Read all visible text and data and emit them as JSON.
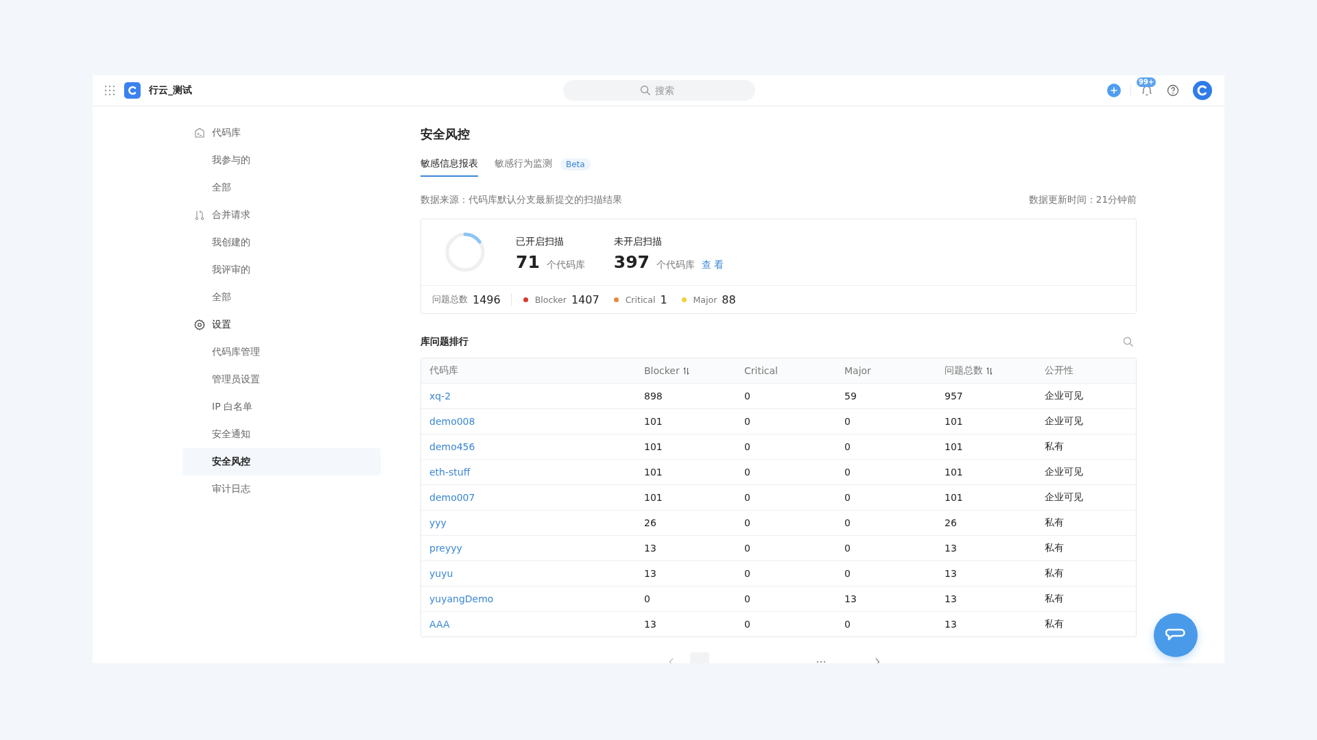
{
  "header": {
    "title": "行云_测试",
    "search": {
      "placeholder": "搜索"
    },
    "notification_badge": "99+"
  },
  "sidebar": {
    "items": [
      {
        "label": "代码库",
        "kind": "repo",
        "selected": false,
        "children": [
          {
            "label": "我参与的",
            "selected": false
          },
          {
            "label": "全部",
            "selected": false
          }
        ]
      },
      {
        "label": "合并请求",
        "kind": "merge",
        "selected": false,
        "children": [
          {
            "label": "我创建的",
            "selected": false
          },
          {
            "label": "我评审的",
            "selected": false
          },
          {
            "label": "全部",
            "selected": false
          }
        ]
      },
      {
        "label": "设置",
        "kind": "settings",
        "selected": false,
        "children": [
          {
            "label": "代码库管理",
            "selected": false
          },
          {
            "label": "管理员设置",
            "selected": false
          },
          {
            "label": "IP 白名单",
            "selected": false
          },
          {
            "label": "安全通知",
            "selected": false
          },
          {
            "label": "安全风控",
            "selected": true
          },
          {
            "label": "审计日志",
            "selected": false
          }
        ]
      }
    ]
  },
  "page": {
    "title": "安全风控",
    "tabs": [
      {
        "label": "敏感信息报表",
        "selected": true
      },
      {
        "label": "敏感行为监测",
        "badge": "Beta",
        "selected": false
      }
    ],
    "source_note": "数据来源：代码库默认分支最新提交的扫描结果",
    "updated_note": "数据更新时间：21分钟前",
    "summary": {
      "level": 0.15,
      "enabled": {
        "label": "已开启扫描",
        "count": "71",
        "unit": "个代码库"
      },
      "disabled": {
        "label": "未开启扫描",
        "count": "397",
        "unit": "个代码库",
        "link": "查 看"
      },
      "total_label": "问题总数",
      "total": "1496",
      "severities": [
        {
          "name": "Blocker",
          "count": "1407",
          "color": "#d9392b"
        },
        {
          "name": "Critical",
          "count": "1",
          "color": "#e8893a"
        },
        {
          "name": "Major",
          "count": "88",
          "color": "#f2cf3b"
        }
      ]
    },
    "ranking": {
      "title": "库问题排行",
      "columns": [
        {
          "label": "代码库",
          "sortable": false
        },
        {
          "label": "Blocker",
          "sortable": true
        },
        {
          "label": "Critical",
          "sortable": false
        },
        {
          "label": "Major",
          "sortable": false
        },
        {
          "label": "问题总数",
          "sortable": true
        },
        {
          "label": "公开性",
          "sortable": false
        }
      ],
      "rows": [
        [
          "xq-2",
          "898",
          "0",
          "59",
          "957",
          "企业可见"
        ],
        [
          "demo008",
          "101",
          "0",
          "0",
          "101",
          "企业可见"
        ],
        [
          "demo456",
          "101",
          "0",
          "0",
          "101",
          "私有"
        ],
        [
          "eth-stuff",
          "101",
          "0",
          "0",
          "101",
          "企业可见"
        ],
        [
          "demo007",
          "101",
          "0",
          "0",
          "101",
          "企业可见"
        ],
        [
          "yyy",
          "26",
          "0",
          "0",
          "26",
          "私有"
        ],
        [
          "preyyy",
          "13",
          "0",
          "0",
          "13",
          "私有"
        ],
        [
          "yuyu",
          "13",
          "0",
          "0",
          "13",
          "私有"
        ],
        [
          "yuyangDemo",
          "0",
          "0",
          "13",
          "13",
          "私有"
        ],
        [
          "AAA",
          "13",
          "0",
          "0",
          "13",
          "私有"
        ]
      ]
    }
  }
}
